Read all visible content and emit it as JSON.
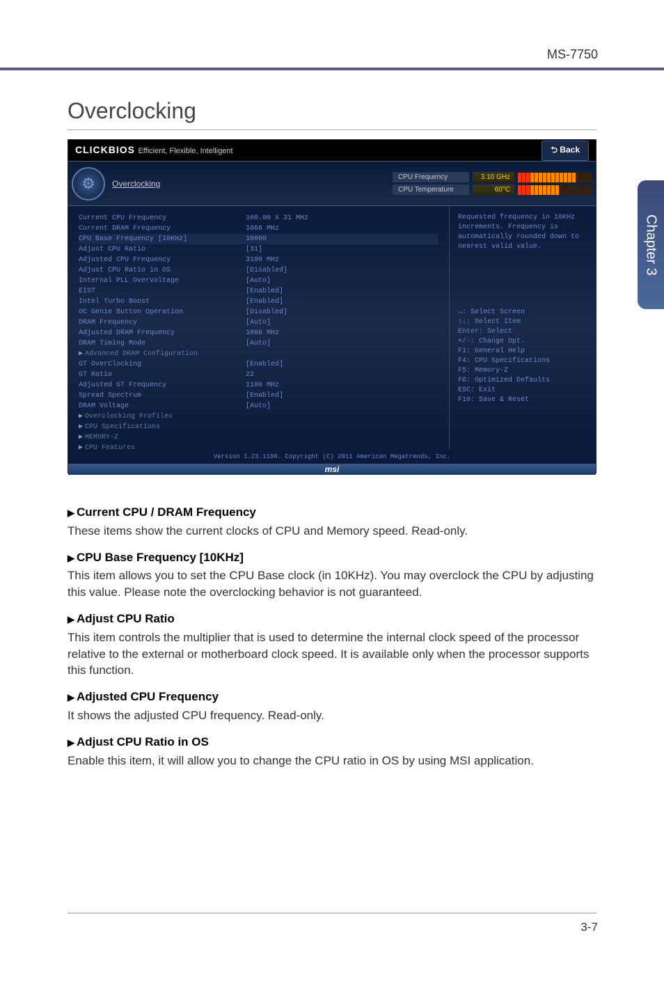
{
  "page": {
    "model": "MS-7750",
    "title": "Overclocking",
    "pageNumber": "3-7",
    "sideTab": "Chapter 3"
  },
  "bios": {
    "logo": "CLICKBIOS",
    "tagline": "Efficient, Flexible, Intelligent",
    "backButton": "⮌ Back",
    "ocLabel": "Overclocking",
    "statusFreq": {
      "label": "CPU Frequency",
      "value": "3.10 GHz"
    },
    "statusTemp": {
      "label": "CPU Temperature",
      "value": "60°C"
    },
    "settings": [
      {
        "label": "Current CPU Frequency",
        "value": "100.00 X 31 MHz"
      },
      {
        "label": "Current DRAM Frequency",
        "value": "1066 MHz"
      },
      {
        "label": "CPU Base Frequency [10KHz]",
        "value": "10000"
      },
      {
        "label": "Adjust CPU Ratio",
        "value": "[31]"
      },
      {
        "label": "Adjusted CPU Frequency",
        "value": "3100 MHz"
      },
      {
        "label": "Adjust CPU Ratio in OS",
        "value": "[Disabled]"
      },
      {
        "label": "Internal PLL Overvoltage",
        "value": "[Auto]"
      },
      {
        "label": "EIST",
        "value": "[Enabled]"
      },
      {
        "label": "Intel Turbo Boost",
        "value": "[Enabled]"
      },
      {
        "label": "OC Genie Button Operation",
        "value": "[Disabled]"
      },
      {
        "label": "DRAM Frequency",
        "value": "[Auto]"
      },
      {
        "label": "Adjusted DRAM Frequency",
        "value": "1066 MHz"
      },
      {
        "label": "DRAM Timing Mode",
        "value": "[Auto]"
      },
      {
        "label": "Advanced DRAM Configuration",
        "value": "",
        "submenu": true
      },
      {
        "label": "GT OverClocking",
        "value": "[Enabled]"
      },
      {
        "label": "GT Ratio",
        "value": "22"
      },
      {
        "label": "Adjusted GT Frequency",
        "value": "1100 MHz"
      },
      {
        "label": "Spread Spectrum",
        "value": "[Enabled]"
      },
      {
        "label": "DRAM Voltage",
        "value": "[Auto]"
      },
      {
        "label": "Overclocking Profiles",
        "value": "",
        "submenu": true
      },
      {
        "label": "CPU Specifications",
        "value": "",
        "submenu": true
      },
      {
        "label": "MEMORY-Z",
        "value": "",
        "submenu": true
      },
      {
        "label": "CPU Features",
        "value": "",
        "submenu": true
      }
    ],
    "helpText": "Requested frequency in 10KHz increments. Frequency is automatically rounded down to nearest valid value.",
    "helpKeys": [
      "↔: Select Screen",
      "↕↓: Select Item",
      "Enter: Select",
      "+/-: Change Opt.",
      "F1: General Help",
      "F4: CPU Specifications",
      "F5: Memory-Z",
      "F6: Optimized Defaults",
      "ESC: Exit",
      "F10: Save & Reset"
    ],
    "footer": "Version 1.23.1108. Copyright (C) 2011 American Megatrends, Inc.",
    "msiLogo": "msi"
  },
  "sections": [
    {
      "title": "Current CPU / DRAM Frequency",
      "text": "These items show the current clocks of CPU and Memory speed. Read-only."
    },
    {
      "title": "CPU Base Frequency [10KHz]",
      "text": "This item allows you to set the CPU Base clock (in 10KHz). You may overclock the CPU by adjusting this value. Please note the overclocking behavior is not guaranteed."
    },
    {
      "title": "Adjust CPU Ratio",
      "text": "This item controls the multiplier that is used to determine the internal clock speed of the processor relative to the external or motherboard clock speed. It is available only when the processor supports this function."
    },
    {
      "title": "Adjusted CPU Frequency",
      "text": "It shows the adjusted CPU frequency. Read-only."
    },
    {
      "title": "Adjust CPU Ratio in OS",
      "text": "Enable this item, it will allow you to change the CPU ratio in OS by using MSI application."
    }
  ]
}
